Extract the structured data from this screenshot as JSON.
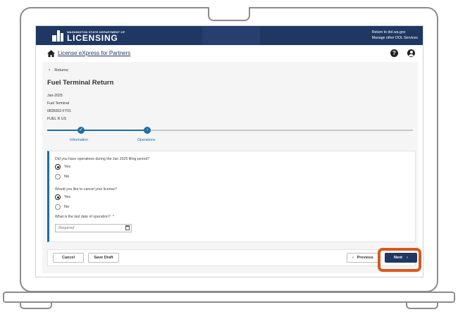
{
  "header": {
    "agency_line": "WASHINGTON STATE DEPARTMENT OF",
    "agency_name": "LICENSING",
    "link_return": "Return to dol.wa.gov",
    "link_manage": "Manage other DOL Services"
  },
  "nav": {
    "brand": "License eXpress for Partners",
    "help_glyph": "?"
  },
  "page": {
    "back_label": "Returns",
    "title": "Fuel Terminal Return",
    "meta": [
      "Jan-2025",
      "Fuel Terminal",
      "0835002-FT01",
      "FUEL R US"
    ]
  },
  "stepper": {
    "steps": [
      {
        "label": "Information",
        "state": "complete",
        "glyph": "✓"
      },
      {
        "label": "Operations",
        "state": "current",
        "glyph": "›"
      }
    ]
  },
  "form": {
    "q1": {
      "label": "Did you have operations during the Jan 2025 filing period?",
      "options": [
        "Yes",
        "No"
      ],
      "selected": "Yes"
    },
    "q2": {
      "label": "Would you like to cancel your license?",
      "options": [
        "Yes",
        "No"
      ],
      "selected": "Yes"
    },
    "q3": {
      "label": "What is the last date of operation?",
      "required_mark": "*",
      "placeholder": "Required",
      "value": ""
    }
  },
  "actions": {
    "cancel": "Cancel",
    "save_draft": "Save Draft",
    "previous": "Previous",
    "previous_glyph": "‹",
    "next": "Next",
    "next_glyph": "›"
  },
  "colors": {
    "header_bg": "#1f3863",
    "accent": "#1c6ea4",
    "highlight": "#d8581e",
    "required": "#cc2222"
  },
  "icons": [
    "home-icon",
    "help-icon",
    "user-icon",
    "chevron-left-icon",
    "check-icon",
    "chevron-right-icon",
    "calendar-icon"
  ]
}
